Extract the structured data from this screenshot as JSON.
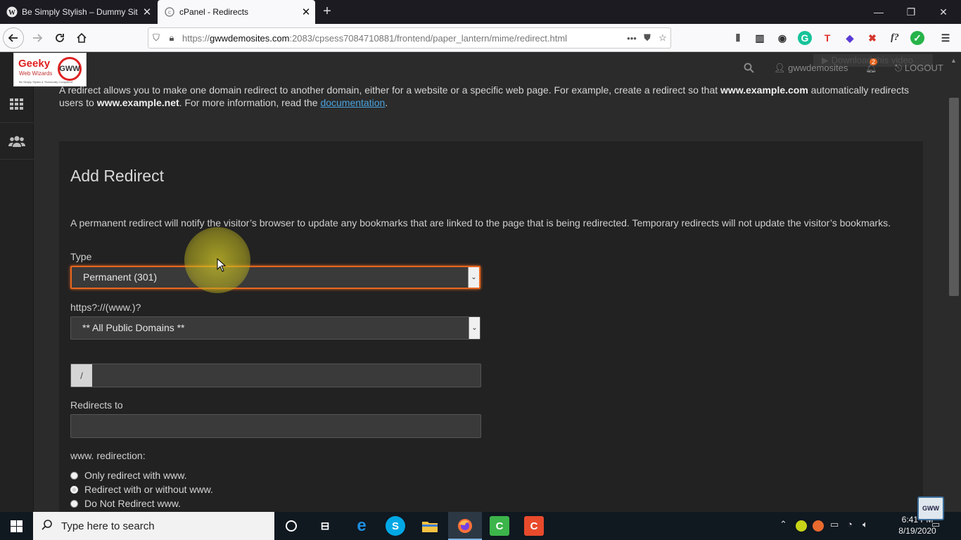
{
  "browser": {
    "tabs": [
      {
        "title": "Be Simply Stylish – Dummy Site",
        "active": false
      },
      {
        "title": "cPanel - Redirects",
        "active": true
      }
    ],
    "url": {
      "prefix": "https://",
      "host": "gwwdemosites.com",
      "rest": ":2083/cpsess7084710881/frontend/paper_lantern/mime/redirect.html"
    },
    "window_controls": [
      "minimize",
      "restore",
      "close"
    ]
  },
  "cpanel": {
    "logo": {
      "brand": "Geeky",
      "sub": "Web Wizards",
      "tagline": "Be Simply Stylish & Technically Competent",
      "mark": "GWW"
    },
    "user": "gwwdemosites",
    "notifications": "2",
    "logout": "LOGOUT",
    "download_overlay": "Download this video",
    "intro": {
      "part1": "A redirect allows you to make one domain redirect to another domain, either for a website or a specific web page. For example, create a redirect so that ",
      "b1": "www.example.com",
      "part2": " automatically redirects users to ",
      "b2": "www.example.net",
      "part3": ". For more information, read the ",
      "link": "documentation",
      "part4": "."
    },
    "form": {
      "title": "Add Redirect",
      "description": "A permanent redirect will notify the visitor’s browser to update any bookmarks that are linked to the page that is being redirected. Temporary redirects will not update the visitor’s bookmarks.",
      "type_label": "Type",
      "type_value": "Permanent (301)",
      "domain_label": "https?://(www.)?",
      "domain_value": "** All Public Domains **",
      "path_prefix": "/",
      "path_value": "",
      "redirects_to_label": "Redirects to",
      "redirects_to_value": "",
      "www_label": "www. redirection:",
      "www_options": [
        {
          "label": "Only redirect with www.",
          "checked": false
        },
        {
          "label": "Redirect with or without www.",
          "checked": true
        },
        {
          "label": "Do Not Redirect www.",
          "checked": false
        }
      ]
    }
  },
  "taskbar": {
    "search_placeholder": "Type here to search",
    "time": "6:41 PM",
    "date": "8/19/2020",
    "watermark": "GWW"
  }
}
